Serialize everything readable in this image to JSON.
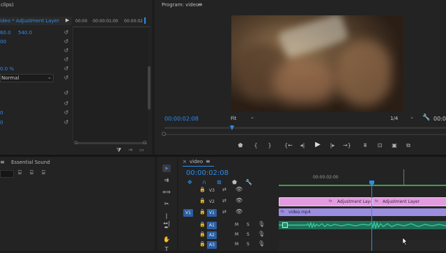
{
  "effect_controls": {
    "tab_fragment": "clips)",
    "clip_name": "ideo * Adjustment Layer",
    "timecodes": [
      "00:00",
      "00:00:01:00",
      "00:00:02"
    ],
    "rows": [
      {
        "value": "60.0",
        "value2": "540.0"
      },
      {
        "value": "00"
      },
      {
        "value": ""
      },
      {
        "value": ""
      },
      {
        "value": ""
      },
      {
        "value": "0.0 %"
      },
      {
        "value": "Normal"
      },
      {
        "value": ""
      },
      {
        "value": ""
      },
      {
        "value": "0"
      },
      {
        "value": ""
      },
      {
        "value": "0"
      }
    ]
  },
  "program": {
    "title": "Program: video",
    "timecode": "00:00:02:08",
    "fit": "Fit",
    "resolution": "1/4",
    "duration_fragment": "00:0"
  },
  "bottom_left": {
    "tab_essential_sound": "Essential Sound"
  },
  "timeline": {
    "title": "video",
    "timecode": "00:00:02:08",
    "ruler_label": "00:00:02:00",
    "tracks": [
      {
        "name": "V3",
        "source": ""
      },
      {
        "name": "V2",
        "source": ""
      },
      {
        "name": "V1",
        "source": "V1"
      },
      {
        "name": "A1",
        "source": ""
      },
      {
        "name": "A2",
        "source": ""
      },
      {
        "name": "A3",
        "source": ""
      }
    ],
    "track_labels": {
      "mute": "M",
      "solo": "S"
    },
    "clips": {
      "adjustment_1": "Adjustment Laye",
      "adjustment_2": "Adjustment Layer",
      "video": "video.mp4",
      "fx": "fx"
    }
  },
  "colors": {
    "accent": "#2d8ceb",
    "adjustment_clip": "#e39be0",
    "video_clip": "#9b8ee0",
    "audio_clip": "#2c9a77"
  }
}
